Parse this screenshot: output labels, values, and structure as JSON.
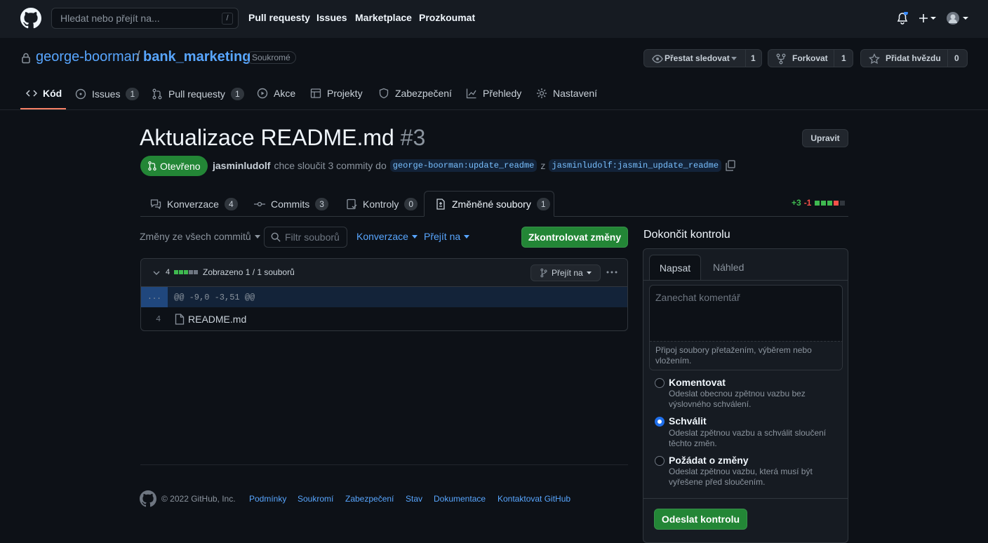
{
  "header": {
    "search_placeholder": "Hledat nebo přejít na...",
    "search_shortcut": "/",
    "nav": [
      "Pull requesty",
      "Issues",
      "Marketplace",
      "Prozkoumat"
    ]
  },
  "repo": {
    "owner": "george-boorman",
    "separator": "/",
    "name": "bank_marketing",
    "visibility": "Soukromé",
    "watch_label": "Přestat sledovat",
    "watch_count": "1",
    "fork_label": "Forkovat",
    "fork_count": "1",
    "star_label": "Přidat hvězdu",
    "star_count": "0"
  },
  "repo_tabs": {
    "code": "Kód",
    "issues": "Issues",
    "issues_count": "1",
    "pulls": "Pull requesty",
    "pulls_count": "1",
    "actions": "Akce",
    "projects": "Projekty",
    "security": "Zabezpečení",
    "insights": "Přehledy",
    "settings": "Nastavení"
  },
  "pr": {
    "title": "Aktualizace README.md",
    "number": "#3",
    "edit_label": "Upravit",
    "state": "Otevřeno",
    "author": "jasminludolf",
    "merge_text": "chce sloučit 3 commity do",
    "base_branch": "george-boorman:update_readme",
    "from_word": "z",
    "head_branch": "jasminludolf:jasmin_update_readme"
  },
  "pr_tabs": {
    "conversation": "Konverzace",
    "conversation_count": "4",
    "commits": "Commits",
    "commits_count": "3",
    "checks": "Kontroly",
    "checks_count": "0",
    "files": "Změněné soubory",
    "files_count": "1",
    "additions": "+3",
    "deletions": "-1"
  },
  "toolbar": {
    "commits_filter": "Změny ze všech commitů",
    "file_filter_placeholder": "Filtr souborů",
    "conversations": "Konverzace",
    "jump_to": "Přejít na",
    "review_button": "Zkontrolovat změny"
  },
  "file_view": {
    "change_count": "4",
    "shown_text": "Zobrazeno 1 / 1 souborů",
    "jump_to": "Přejít na",
    "expand_marker": "...",
    "hunk_header": "@@ -9,0 -3,51 @@",
    "line_number": "4",
    "file_name": "README.md"
  },
  "review": {
    "title": "Dokončit kontrolu",
    "tab_write": "Napsat",
    "tab_preview": "Náhled",
    "comment_placeholder": "Zanechat komentář",
    "attach_hint": "Připoj soubory přetažením, výběrem nebo vložením.",
    "options": [
      {
        "label": "Komentovat",
        "desc": "Odeslat obecnou zpětnou vazbu bez výslovného schválení.",
        "selected": false
      },
      {
        "label": "Schválit",
        "desc": "Odeslat zpětnou vazbu a schválit sloučení těchto změn.",
        "selected": true
      },
      {
        "label": "Požádat o změny",
        "desc": "Odeslat zpětnou vazbu, která musí být vyřešene před sloučením.",
        "selected": false
      }
    ],
    "submit": "Odeslat kontrolu"
  },
  "footer": {
    "copyright": "© 2022 GitHub, Inc.",
    "links": [
      "Podmínky",
      "Soukromí",
      "Zabezpečení",
      "Stav",
      "Dokumentace",
      "Kontaktovat GitHub"
    ]
  },
  "colors": {
    "accent": "#58a6ff",
    "success": "#238636",
    "danger": "#f85149",
    "background": "#0d1117"
  }
}
